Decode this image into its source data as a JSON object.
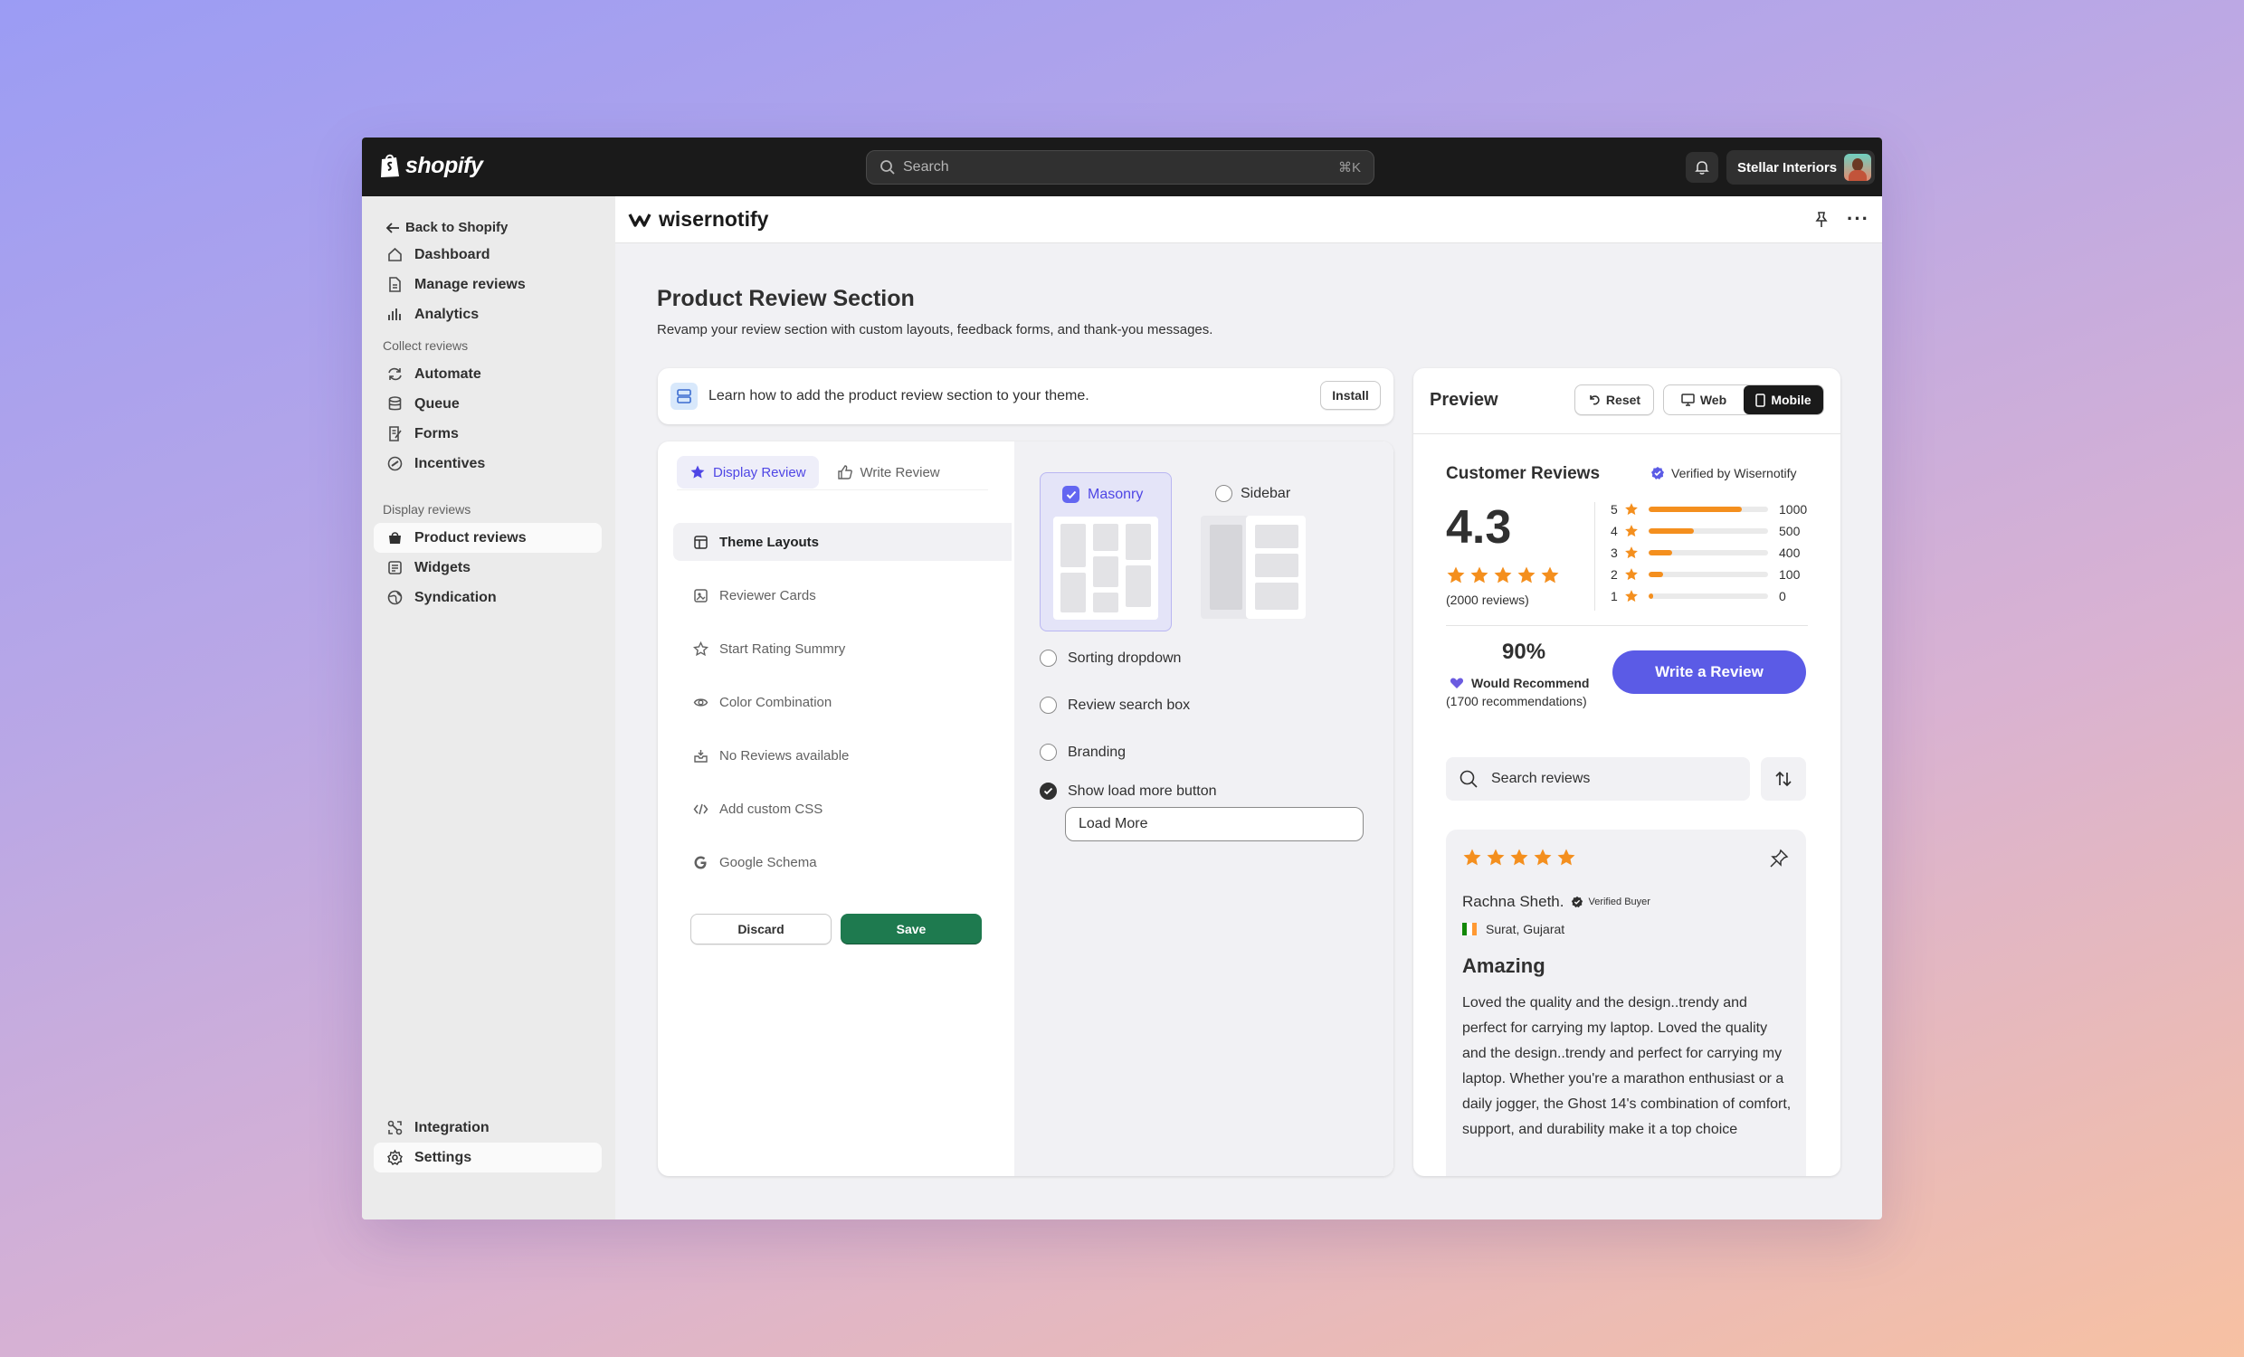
{
  "topbar": {
    "brand": "shopify",
    "search_placeholder": "Search",
    "search_shortcut": "⌘K",
    "store_name": "Stellar Interiors",
    "icons": [
      "shopify-bag-icon",
      "search-icon",
      "bell-icon",
      "avatar"
    ]
  },
  "sidebar": {
    "back_label": "Back to Shopify",
    "main_items": [
      {
        "label": "Dashboard",
        "icon": "home-icon"
      },
      {
        "label": "Manage reviews",
        "icon": "document-icon"
      },
      {
        "label": "Analytics",
        "icon": "bar-chart-icon"
      }
    ],
    "collect_label": "Collect reviews",
    "collect_items": [
      {
        "label": "Automate",
        "icon": "refresh-icon"
      },
      {
        "label": "Queue",
        "icon": "database-icon"
      },
      {
        "label": "Forms",
        "icon": "form-icon"
      },
      {
        "label": "Incentives",
        "icon": "badge-icon"
      }
    ],
    "display_label": "Display reviews",
    "display_items": [
      {
        "label": "Product reviews",
        "icon": "bag-icon",
        "active": true
      },
      {
        "label": "Widgets",
        "icon": "widget-icon"
      },
      {
        "label": "Syndication",
        "icon": "globe-icon"
      }
    ],
    "bottom_items": [
      {
        "label": "Integration",
        "icon": "integration-icon"
      },
      {
        "label": "Settings",
        "icon": "gear-icon",
        "active": true
      }
    ]
  },
  "appbar": {
    "app_name": "wisernotify"
  },
  "page": {
    "title": "Product Review Section",
    "subtitle": "Revamp your review section with custom layouts, feedback forms, and thank-you messages."
  },
  "banner": {
    "text": "Learn how to add the product review section to your theme.",
    "install_label": "Install"
  },
  "settings": {
    "tabs": [
      {
        "label": "Display Review",
        "active": true
      },
      {
        "label": "Write Review",
        "active": false
      }
    ],
    "menu": [
      {
        "label": "Theme Layouts",
        "icon": "layout-icon",
        "active": true
      },
      {
        "label": "Reviewer Cards",
        "icon": "card-icon"
      },
      {
        "label": "Start Rating Summry",
        "icon": "star-outline-icon"
      },
      {
        "label": "Color Combination",
        "icon": "eye-icon"
      },
      {
        "label": "No Reviews available",
        "icon": "inbox-icon"
      },
      {
        "label": "Add custom CSS",
        "icon": "code-icon"
      },
      {
        "label": "Google Schema",
        "icon": "google-icon"
      }
    ],
    "discard_label": "Discard",
    "save_label": "Save",
    "layouts": [
      {
        "label": "Masonry",
        "selected": true
      },
      {
        "label": "Sidebar",
        "selected": false
      }
    ],
    "options": [
      {
        "label": "Sorting dropdown",
        "checked": false
      },
      {
        "label": "Review search box",
        "checked": false
      },
      {
        "label": "Branding",
        "checked": false
      },
      {
        "label": "Show load more button",
        "checked": true
      }
    ],
    "load_more_value": "Load More"
  },
  "preview": {
    "title": "Preview",
    "reset_label": "Reset",
    "web_label": "Web",
    "mobile_label": "Mobile",
    "device_selected": "Mobile",
    "customer_reviews_label": "Customer Reviews",
    "verified_label": "Verified by Wisernotify",
    "average": "4.3",
    "stars_filled": 5,
    "review_count": "(2000 reviews)",
    "distribution": [
      {
        "stars": "5",
        "count": "1000",
        "fraction": 0.78
      },
      {
        "stars": "4",
        "count": "500",
        "fraction": 0.38
      },
      {
        "stars": "3",
        "count": "400",
        "fraction": 0.2
      },
      {
        "stars": "2",
        "count": "100",
        "fraction": 0.12
      },
      {
        "stars": "1",
        "count": "0",
        "fraction": 0.04
      }
    ],
    "recommend_pct": "90%",
    "recommend_label": "Would Recommend",
    "recommend_count": "(1700 recommendations)",
    "write_review_label": "Write a Review",
    "search_placeholder": "Search reviews",
    "review": {
      "stars": 5,
      "name": "Rachna Sheth.",
      "badge": "Verified Buyer",
      "location": "Surat, Gujarat",
      "headline": "Amazing",
      "body": "Loved the quality and the design..trendy and perfect for carrying my laptop. Loved the quality and the design..trendy and perfect for carrying my laptop. Whether you're a marathon enthusiast or a daily jogger, the Ghost 14's combination of comfort, support, and durability make it a top choice"
    }
  },
  "colors": {
    "accent": "#5b5be6",
    "save_green": "#1e7a4f",
    "star_orange": "#f48f1e",
    "topbar": "#1a1a1a"
  }
}
